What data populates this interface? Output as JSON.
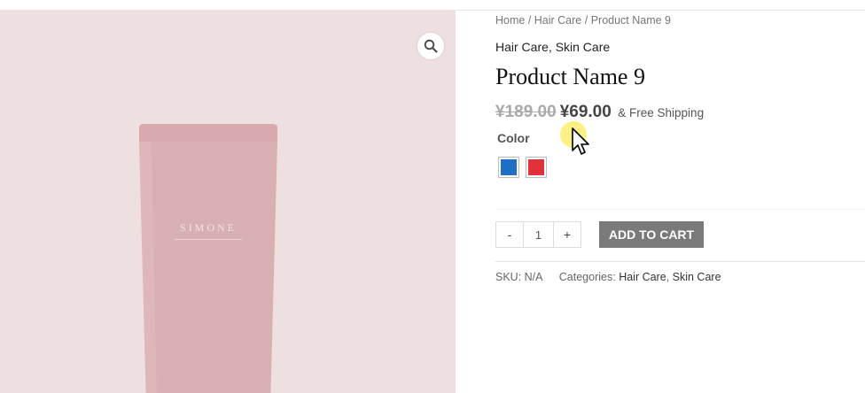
{
  "breadcrumb": {
    "home": "Home",
    "sep1": " / ",
    "category": "Hair Care",
    "sep2": " / ",
    "current": "Product Name 9"
  },
  "categories": {
    "first": "Hair Care",
    "sep": ", ",
    "second": "Skin Care"
  },
  "product": {
    "title": "Product Name 9",
    "brand_on_image": "SIMONE",
    "old_price": "¥189.00",
    "new_price": "¥69.00",
    "shipping": "& Free Shipping"
  },
  "variations": {
    "color_label": "Color",
    "swatches": [
      {
        "name": "Blue",
        "color": "#1f6fc4"
      },
      {
        "name": "Red",
        "color": "#e0323a"
      }
    ]
  },
  "cart": {
    "minus": "-",
    "quantity": "1",
    "plus": "+",
    "add_to_cart": "ADD TO CART"
  },
  "meta": {
    "sku_label": "SKU: ",
    "sku_value": "N/A",
    "categories_label": "Categories: ",
    "cat1": "Hair Care",
    "cat_sep": ", ",
    "cat2": "Skin Care"
  },
  "icons": {
    "zoom": "magnifier-icon",
    "cursor": "mouse-pointer-icon"
  },
  "colors": {
    "image_bg": "#eee0e0",
    "tube": "#d9b0b2",
    "button_bg": "#7a7a7a"
  }
}
